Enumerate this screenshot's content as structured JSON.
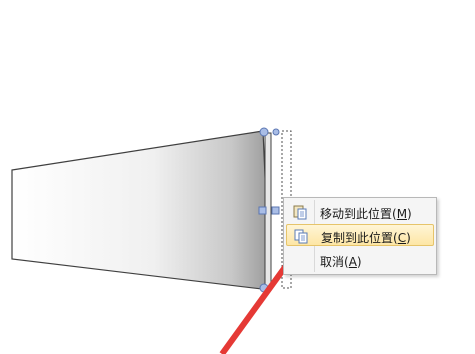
{
  "context_menu": {
    "items": [
      {
        "icon": "paste-icon",
        "label": "移动到此位置(",
        "mnemonic": "M",
        "suffix": ")",
        "highlighted": false
      },
      {
        "icon": "copy-icon",
        "label": "复制到此位置(",
        "mnemonic": "C",
        "suffix": ")",
        "highlighted": true
      },
      {
        "icon": "",
        "label": "取消(",
        "mnemonic": "A",
        "suffix": ")",
        "highlighted": false
      }
    ]
  },
  "colors": {
    "arrow": "#e53935",
    "menu_highlight": "#fde6a5",
    "handle": "#8aa6d8"
  }
}
